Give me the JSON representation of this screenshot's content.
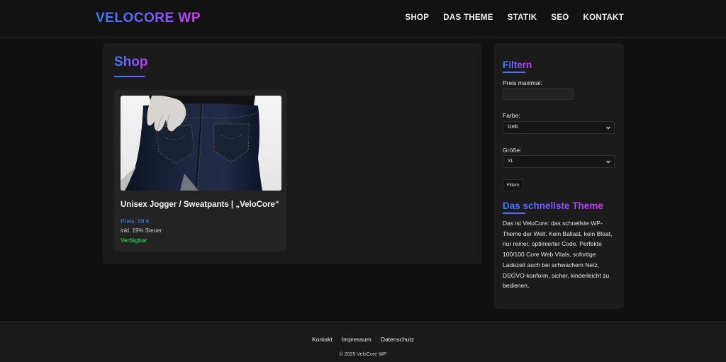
{
  "header": {
    "brand": "VELOCORE WP",
    "nav": [
      "SHOP",
      "DAS THEME",
      "STATIK",
      "SEO",
      "KONTAKT"
    ]
  },
  "main": {
    "title": "Shop",
    "products": [
      {
        "name": "Unisex Jogger / Sweatpants | „VeloCore“",
        "price": "Preis: 59 €",
        "tax": "inkl. 19% Steuer",
        "stock": "Verfügbar"
      }
    ]
  },
  "sidebar": {
    "filter": {
      "title": "Filtern",
      "price_label": "Preis maximal:",
      "price_value": "",
      "color_label": "Farbe:",
      "color_value": "Gelb",
      "size_label": "Größe:",
      "size_value": "XL",
      "button_label": "Filtern"
    },
    "about": {
      "title": "Das schnellste Theme",
      "text": "Das ist VeloCore: das schnellste WP-Theme der Welt. Kein Ballast, kein Bloat, nur reiner, optimierter Code. Perfekte 100/100 Core Web Vitals, sofortige Ladezeit auch bei schwachem Netz, DSGVO-konform, sicher, kinderleicht zu bedienen."
    }
  },
  "footer": {
    "links": [
      "Kontakt",
      "Impressum",
      "Datenschutz"
    ],
    "copyright": "© 2025 VeloCore WP"
  },
  "colors": {
    "background": "#111111",
    "card": "#1b1b1b",
    "accent_blue": "#3a7bff",
    "accent_purple": "#d63cf0",
    "price_blue": "#3a86ff",
    "stock_green": "#2fbf5a"
  }
}
